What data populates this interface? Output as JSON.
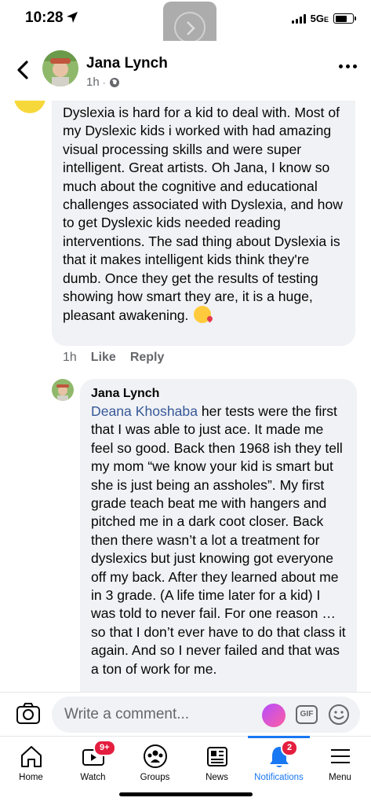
{
  "status_bar": {
    "time": "10:28",
    "network": "5G",
    "network_suffix": "E"
  },
  "header": {
    "name": "Jana Lynch",
    "time": "1h",
    "privacy_icon": "globe-icon"
  },
  "comment": {
    "text": "Dyslexia is hard for a kid to deal with. Most of my Dyslexic kids i worked with had amazing visual processing skills and were super intelligent. Great artists. Oh Jana, I know so much about the cognitive and educational challenges associated with Dyslexia, and how to get Dyslexic kids needed reading interventions. The sad thing about Dyslexia is that it makes intelligent kids think they're dumb. Once they get the results of testing showing how smart they are, it is a huge, pleasant awakening.",
    "emoji": "face-blowing-kiss",
    "time": "1h",
    "like_label": "Like",
    "reply_label": "Reply"
  },
  "reply": {
    "author": "Jana Lynch",
    "mention": "Deana Khoshaba",
    "text": " her tests were the first that I was able to just ace. It made me feel so good. Back then 1968 ish  they tell my mom “we know your kid is smart but she is just being an assholes”. My first grade teach beat me with hangers and pitched me in a dark coot closer. Back then there wasn’t a lot a treatment for dyslexics but just knowing got everyone off my back. After they learned about me in 3 grade. (A life time later for a kid) I was told to never fail. For one reason … so that I don’t ever have to do that class it again. And so I never failed and that was a ton of work for me."
  },
  "composer": {
    "placeholder": "Write a comment...",
    "gif_label": "GIF"
  },
  "tabs": [
    {
      "label": "Home",
      "icon": "home-icon"
    },
    {
      "label": "Watch",
      "icon": "watch-icon",
      "badge": "9+"
    },
    {
      "label": "Groups",
      "icon": "groups-icon"
    },
    {
      "label": "News",
      "icon": "news-icon"
    },
    {
      "label": "Notifications",
      "icon": "bell-icon",
      "badge": "2",
      "active": true
    },
    {
      "label": "Menu",
      "icon": "menu-icon"
    }
  ],
  "colors": {
    "accent": "#1877f2",
    "badge": "#e41e3f",
    "bubble": "#f0f2f5",
    "mention": "#385898"
  }
}
